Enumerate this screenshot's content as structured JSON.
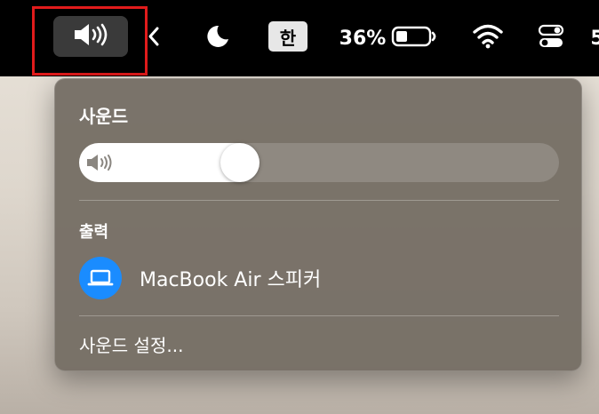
{
  "menubar": {
    "input_method": "한",
    "battery_percent": "36%",
    "battery_level": 0.36,
    "overflow_glyph": "5",
    "icons": [
      "speaker-icon",
      "chevron-left-icon",
      "moon-icon",
      "battery-icon",
      "wifi-icon",
      "control-center-icon"
    ]
  },
  "panel": {
    "title": "사운드",
    "volume_level": 0.32,
    "output_section_label": "출력",
    "device_name": "MacBook Air 스피커",
    "settings_link": "사운드 설정..."
  },
  "colors": {
    "device_icon_bg": "#1a8cff",
    "highlight_box": "#e11b1b"
  }
}
